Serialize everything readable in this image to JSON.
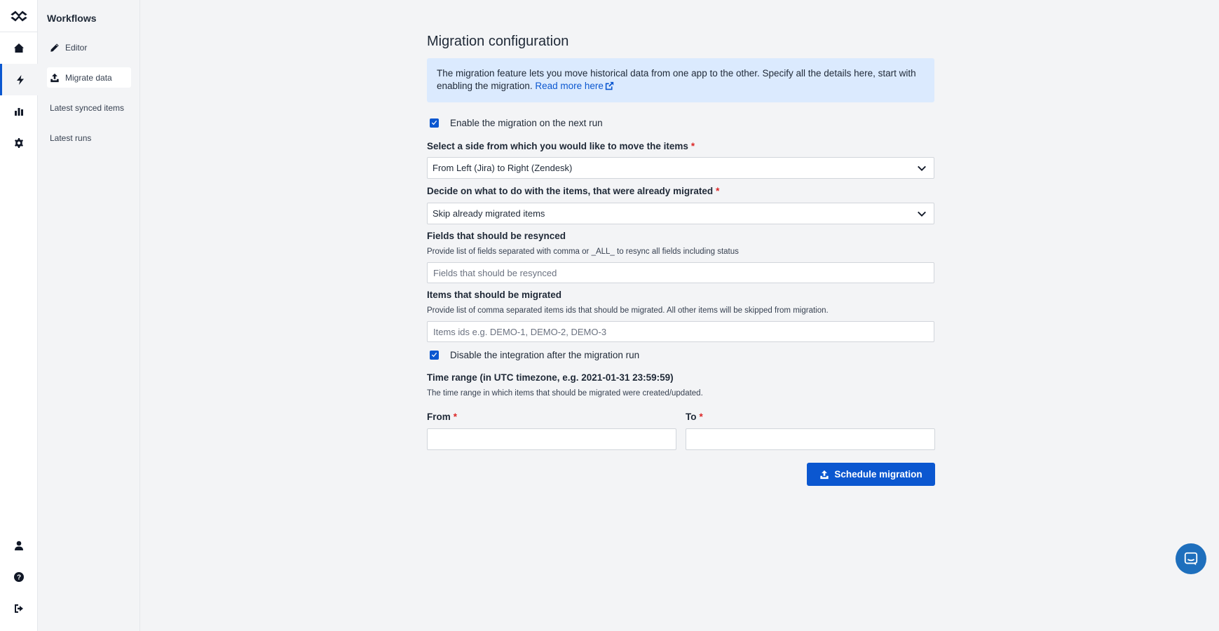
{
  "sidebar": {
    "title": "Workflows",
    "items": [
      {
        "label": "Editor",
        "icon": "pencil-icon"
      },
      {
        "label": "Migrate data",
        "icon": "upload-icon"
      },
      {
        "label": "Latest synced items"
      },
      {
        "label": "Latest runs"
      }
    ]
  },
  "rail": {
    "items": [
      "logo-icon",
      "home-icon",
      "bolt-icon",
      "chart-icon",
      "gear-icon",
      "user-icon",
      "help-icon",
      "logout-icon"
    ]
  },
  "main": {
    "title": "Migration configuration",
    "info_text": "The migration feature lets you move historical data from one app to the other. Specify all the details here, start with enabling the migration.",
    "info_link": "Read more here",
    "enable_label": "Enable the migration on the next run",
    "enable_checked": true,
    "side_label": "Select a side from which you would like to move the items",
    "side_value": "From Left (Jira) to Right (Zendesk)",
    "decide_label": "Decide on what to do with the items, that were already migrated",
    "decide_value": "Skip already migrated items",
    "fields_label": "Fields that should be resynced",
    "fields_help": "Provide list of fields separated with comma or _ALL_ to resync all fields including status",
    "fields_placeholder": "Fields that should be resynced",
    "items_label": "Items that should be migrated",
    "items_help": "Provide list of comma separated items ids that should be migrated. All other items will be skipped from migration.",
    "items_placeholder": "Items ids e.g. DEMO-1, DEMO-2, DEMO-3",
    "disable_label": "Disable the integration after the migration run",
    "disable_checked": true,
    "time_label": "Time range (in UTC timezone, e.g. 2021-01-31 23:59:59)",
    "time_help": "The time range in which items that should be migrated were created/updated.",
    "from_label": "From",
    "to_label": "To",
    "required_mark": "*",
    "submit_label": "Schedule migration"
  },
  "colors": {
    "accent": "#0b57d0",
    "info_bg": "#dbeafe",
    "required": "#dc2626"
  }
}
